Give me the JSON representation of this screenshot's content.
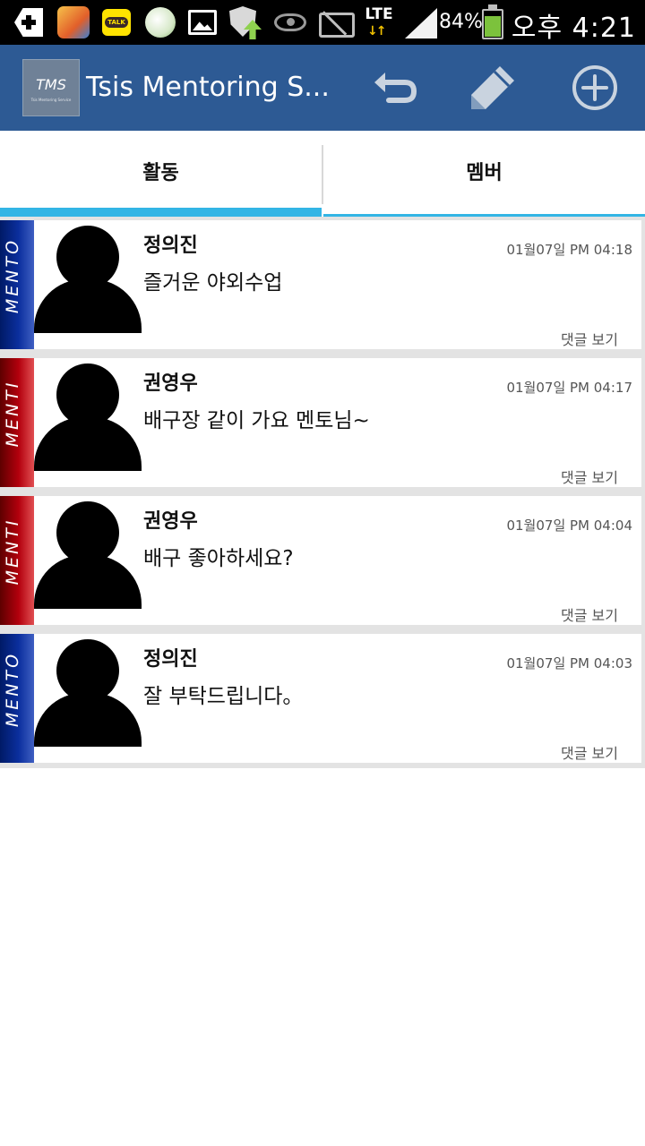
{
  "status_bar": {
    "lte": "LTE",
    "lte_arrows": "↓↑",
    "battery_percent": "84%",
    "time": "오후 4:21",
    "icons": [
      "add-notification-icon",
      "game-app-icon",
      "kakaotalk-icon",
      "frog-app-icon",
      "image-icon",
      "security-shield-icon",
      "eye-icon",
      "vibrate-mode-icon",
      "lte-icon",
      "signal-icon",
      "battery-icon"
    ],
    "talk_badge": "TALK"
  },
  "action_bar": {
    "logo_text": "TMS",
    "logo_subtext": "Tsis Mentoring Service",
    "title": "Tsis Mentoring S...",
    "color": "#2d5a94",
    "icons": [
      "undo-icon",
      "pencil-icon",
      "add-circle-icon"
    ]
  },
  "tabs": [
    {
      "label": "활동",
      "selected": true
    },
    {
      "label": "멤버",
      "selected": false
    }
  ],
  "accent_color": "#33b5e5",
  "role_colors": {
    "MENTO": "#0b2f9e",
    "MENTI": "#b3000d"
  },
  "posts": [
    {
      "role": "MENTO",
      "name": "정의진",
      "time": "01월07일 PM 04:18",
      "text": "즐거운 야외수업",
      "comment": "댓글 보기"
    },
    {
      "role": "MENTI",
      "name": "권영우",
      "time": "01월07일 PM 04:17",
      "text": "배구장 같이 가요 멘토님~",
      "comment": "댓글 보기"
    },
    {
      "role": "MENTI",
      "name": "권영우",
      "time": "01월07일 PM 04:04",
      "text": "배구 좋아하세요?",
      "comment": "댓글 보기"
    },
    {
      "role": "MENTO",
      "name": "정의진",
      "time": "01월07일 PM 04:03",
      "text": "잘 부탁드립니다。",
      "comment": "댓글 보기"
    }
  ]
}
